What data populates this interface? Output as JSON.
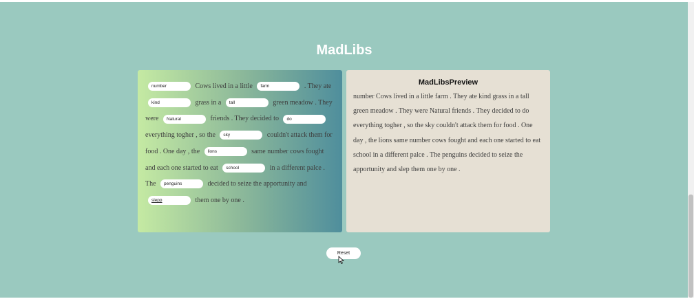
{
  "app": {
    "title": "MadLibs"
  },
  "story": {
    "inputs": {
      "number": "number",
      "place": "farm",
      "adjective1": "kind",
      "adjective2": "tall",
      "adjective3": "Natural",
      "verb1": "do",
      "noun1": "sky",
      "animal": "lions",
      "place2": "school",
      "animal2": "penguins",
      "verb2": "slepp"
    },
    "text": {
      "t1": "Cows lived in a little",
      "t2": ". They ate",
      "t3": "grass in a",
      "t4": "green meadow . They were",
      "t5": "friends . They decided to",
      "t6": "everything togher , so the",
      "t7": "couldn't attack them for food . One day , the",
      "t8": "same number cows fought and each one started to eat",
      "t9": "in a different palce . The",
      "t10": "decided to seize the apportunity and",
      "t11": "them one by one ."
    }
  },
  "preview": {
    "title": "MadLibsPreview",
    "text": "number Cows lived in a little farm . They ate kind grass in a tall green meadow . They were Natural friends . They decided to do everything togher , so the sky couldn't attack them for food . One day , the lions same number cows fought and each one started to eat school in a different palce . The penguins decided to seize the apportunity and slep them one by one ."
  },
  "reset": {
    "label": "Reset"
  },
  "colors": {
    "background": "#9ac9bf",
    "preview_bg": "#e6e0d4",
    "gradient_start": "#c5eaa3",
    "gradient_end": "#4f8e9c"
  }
}
